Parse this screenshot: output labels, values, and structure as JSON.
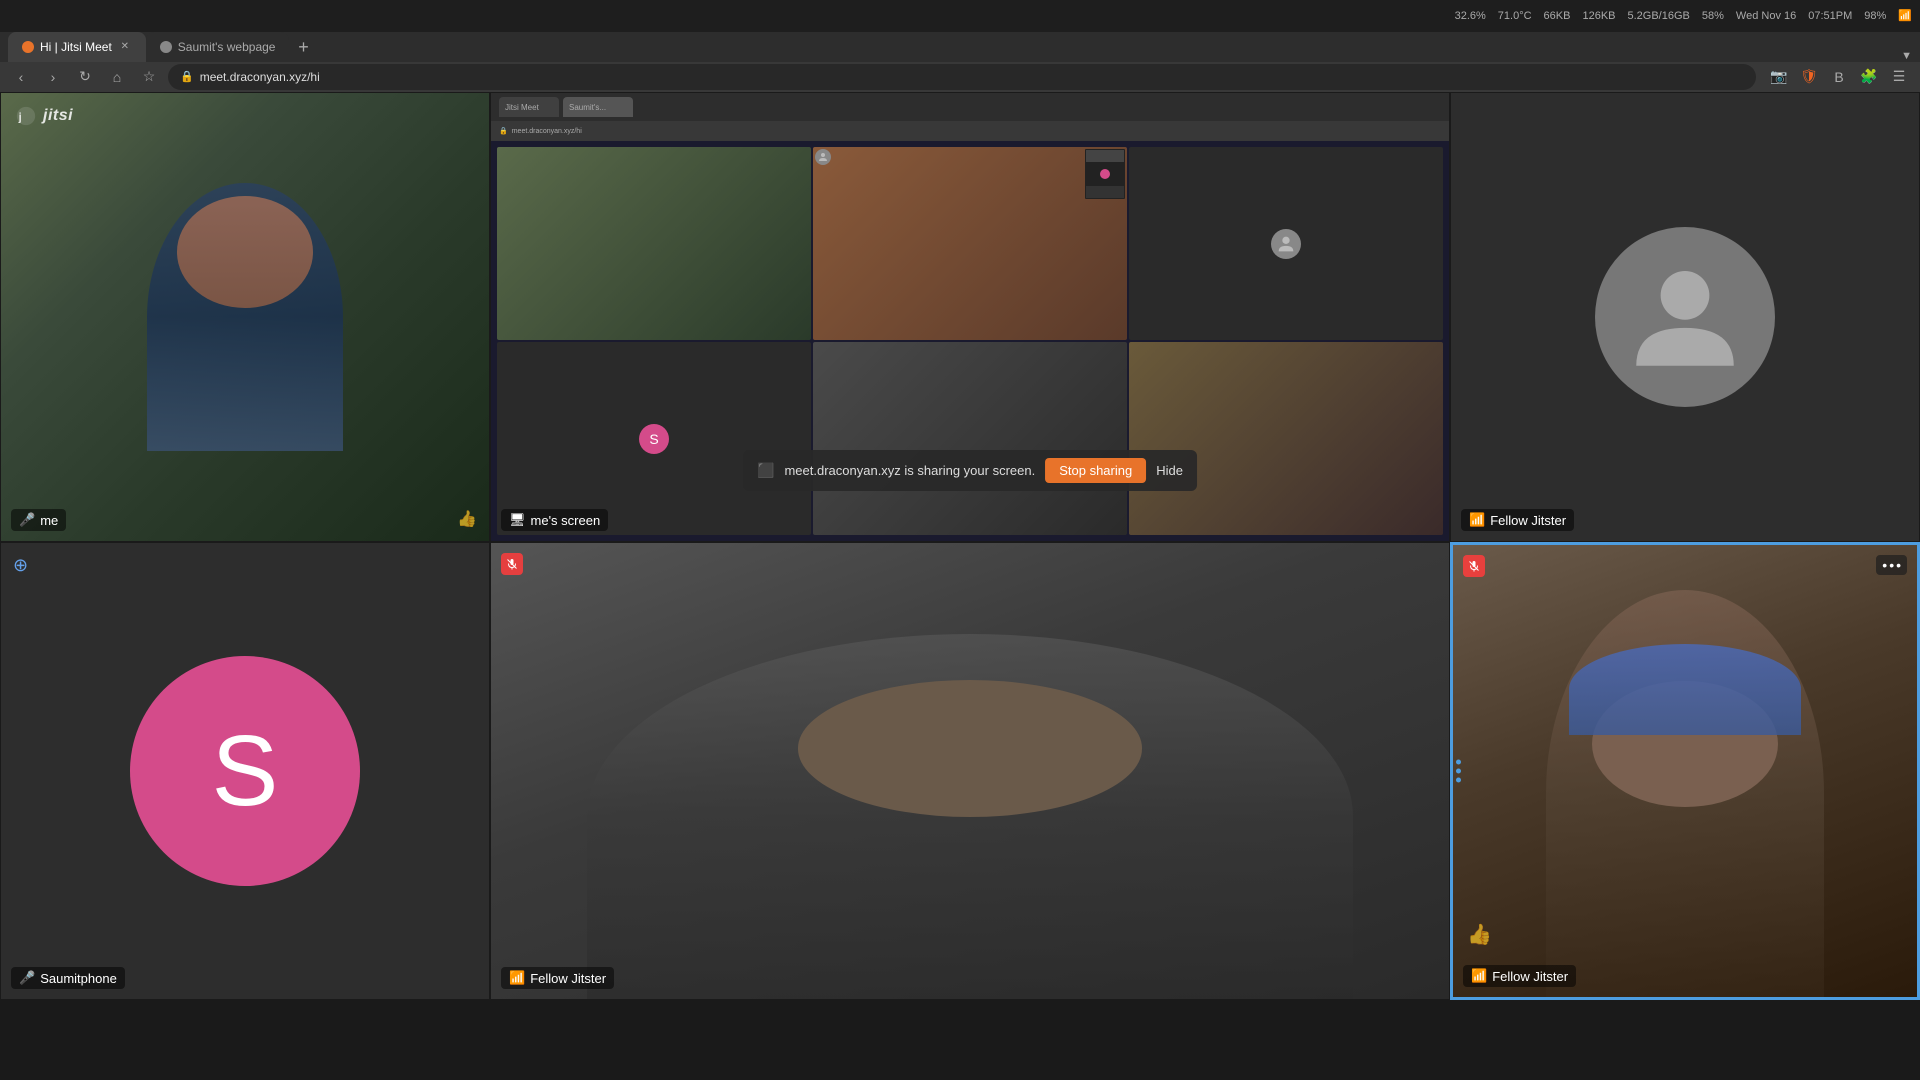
{
  "browser": {
    "title": "Hi | Jitsi Meet - Brave",
    "tabs": [
      {
        "label": "Hi | Jitsi Meet",
        "active": true,
        "favicon": "jitsi"
      },
      {
        "label": "Saumit's webpage",
        "active": false,
        "favicon": "web"
      }
    ],
    "address": "meet.draconyan.xyz/hi",
    "new_tab_label": "+"
  },
  "statusbar": {
    "items": [
      "32.6%",
      "71.0°C",
      "66KB",
      "126KB",
      "5.2GB/16GB",
      "58%",
      "Wed Nov 16",
      "07:51PM",
      "98%"
    ]
  },
  "jitsi": {
    "logo": "jitsi"
  },
  "cells": [
    {
      "id": "me",
      "label": "me",
      "position": "top-left",
      "muted": false,
      "type": "video"
    },
    {
      "id": "mes_screen",
      "label": "me's screen",
      "position": "top-center",
      "type": "screen",
      "banner": {
        "text": "meet.draconyan.xyz is sharing your screen.",
        "stop_label": "Stop sharing",
        "hide_label": "Hide"
      }
    },
    {
      "id": "fellow_top_right",
      "label": "Fellow Jitster",
      "position": "top-right",
      "type": "avatar"
    },
    {
      "id": "saumitphone",
      "label": "Saumitphone",
      "position": "bottom-left",
      "type": "s-avatar"
    },
    {
      "id": "fellow_bottom_mid",
      "label": "Fellow Jitster",
      "position": "bottom-center",
      "muted": true,
      "type": "video"
    },
    {
      "id": "fellow_bottom_right",
      "label": "Fellow Jitster",
      "position": "bottom-right",
      "muted": true,
      "type": "video",
      "active_speaker": true
    }
  ]
}
